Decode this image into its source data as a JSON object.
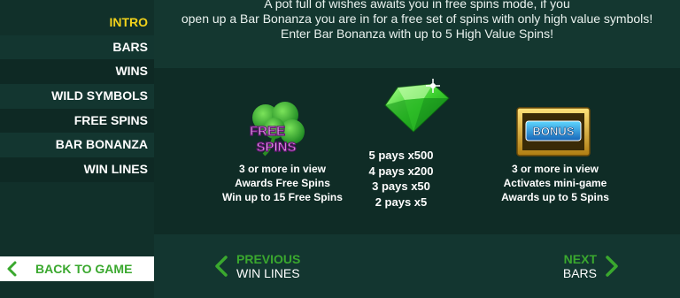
{
  "sidebar": {
    "items": [
      {
        "label": "INTRO",
        "active": true
      },
      {
        "label": "BARS",
        "active": false
      },
      {
        "label": "WINS",
        "active": false
      },
      {
        "label": "WILD SYMBOLS",
        "active": false
      },
      {
        "label": "FREE SPINS",
        "active": false
      },
      {
        "label": "BAR BONANZA",
        "active": false
      },
      {
        "label": "WIN LINES",
        "active": false
      }
    ],
    "back_label": "BACK TO GAME"
  },
  "intro": {
    "line1": "A pot full of wishes awaits you in free spins mode, if you",
    "line2": "open up a Bar Bonanza you are in for a free set of spins with only high value symbols!",
    "line3": "Enter Bar Bonanza with up to 5 High Value Spins!"
  },
  "symbols": [
    {
      "icon": "free-spins-clover-icon",
      "logo_text": [
        "FREE",
        "SPINS"
      ],
      "lines": [
        "3 or more in view",
        "Awards Free Spins",
        "Win up to 15 Free Spins"
      ]
    },
    {
      "icon": "green-gem-icon",
      "lines": [
        "5 pays x500",
        "4 pays x200",
        "3 pays x50",
        "2 pays x5"
      ]
    },
    {
      "icon": "bonus-plaque-icon",
      "logo_text": "BONUS",
      "lines": [
        "3 or more in view",
        "Activates mini-game",
        "Awards up to 5 Spins"
      ]
    }
  ],
  "nav": {
    "prev": {
      "title": "PREVIOUS",
      "subtitle": "WIN LINES"
    },
    "next": {
      "title": "NEXT",
      "subtitle": "BARS"
    }
  },
  "colors": {
    "accent_green": "#3aa82e",
    "active_yellow": "#f2d21b",
    "background": "#143730"
  }
}
